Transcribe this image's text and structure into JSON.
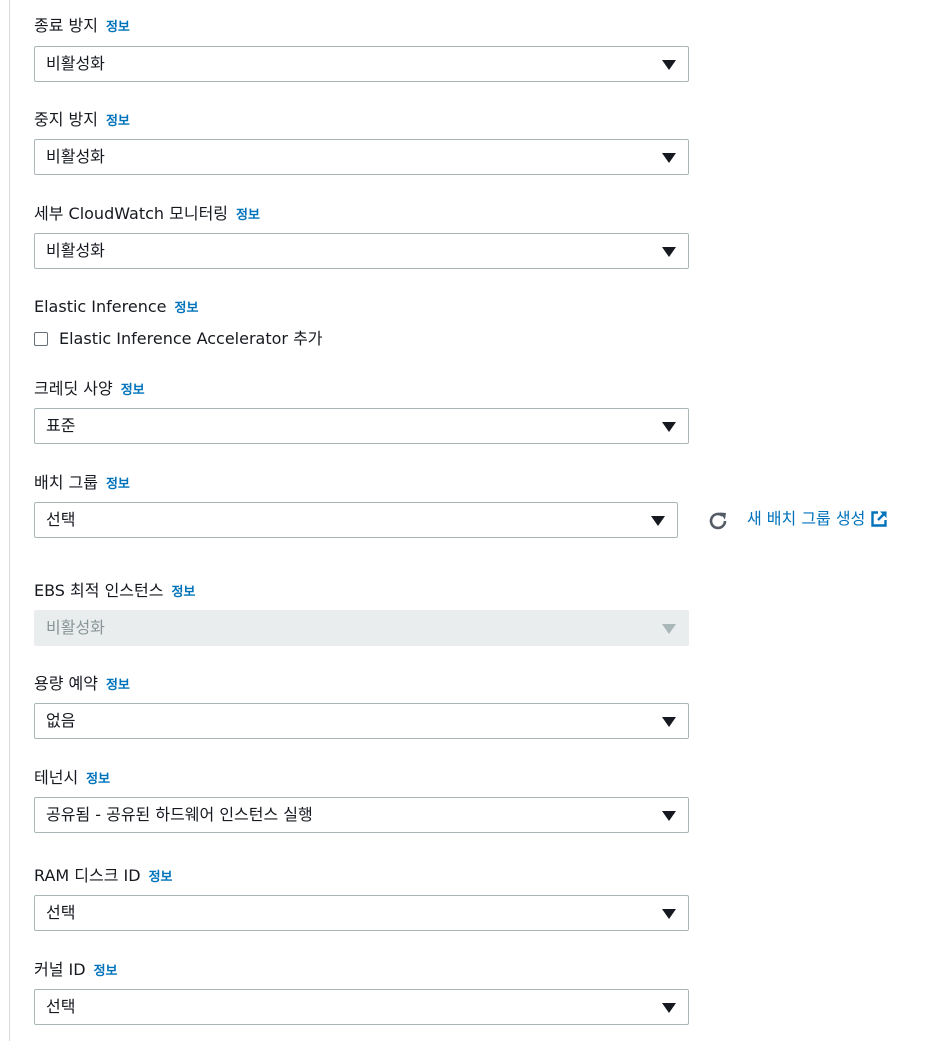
{
  "info_label": "정보",
  "termination_protection": {
    "label": "종료 방지",
    "value": "비활성화"
  },
  "stop_protection": {
    "label": "중지 방지",
    "value": "비활성화"
  },
  "detailed_monitoring": {
    "label": "세부 CloudWatch 모니터링",
    "value": "비활성화"
  },
  "elastic_inference": {
    "label": "Elastic Inference",
    "checkbox_label": "Elastic Inference Accelerator 추가",
    "checked": false
  },
  "credit_specification": {
    "label": "크레딧 사양",
    "value": "표준"
  },
  "placement_group": {
    "label": "배치 그룹",
    "value": "선택",
    "create_link": "새 배치 그룹 생성"
  },
  "ebs_optimized": {
    "label": "EBS 최적 인스턴스",
    "value": "비활성화",
    "disabled": true
  },
  "capacity_reservation": {
    "label": "용량 예약",
    "value": "없음"
  },
  "tenancy": {
    "label": "테넌시",
    "value": "공유됨 - 공유된 하드웨어 인스턴스 실행"
  },
  "ramdisk_id": {
    "label": "RAM 디스크 ID",
    "value": "선택"
  },
  "kernel_id": {
    "label": "커널 ID",
    "value": "선택"
  },
  "colors": {
    "link": "#0073bb",
    "border": "#aab7b8",
    "disabled_bg": "#eaeded"
  }
}
